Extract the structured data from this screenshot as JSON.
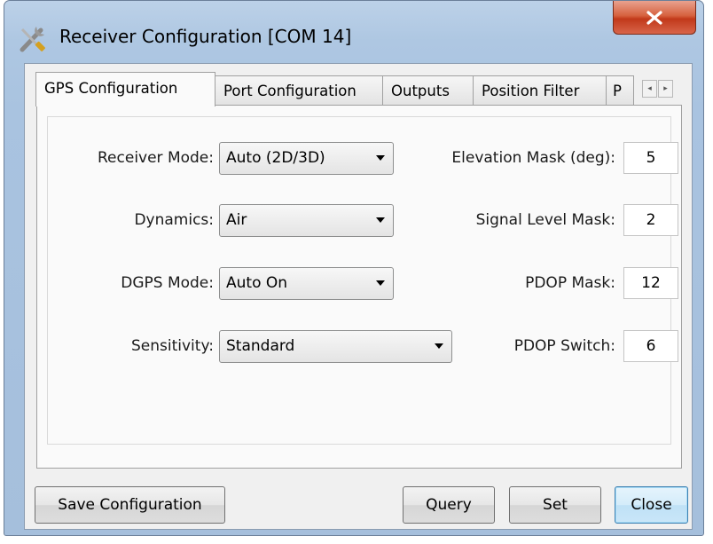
{
  "window": {
    "title": "Receiver Configuration [COM 14]",
    "close_glyph": "x"
  },
  "tabs": [
    {
      "label": "GPS Configuration",
      "active": true
    },
    {
      "label": "Port Configuration",
      "active": false
    },
    {
      "label": "Outputs",
      "active": false
    },
    {
      "label": "Position Filter",
      "active": false
    },
    {
      "label": "P",
      "active": false
    }
  ],
  "tab_scroll": {
    "left_icon": "arrow-left-icon",
    "right_icon": "arrow-right-icon",
    "left": "◂",
    "right": "▸"
  },
  "gps": {
    "receiver_mode": {
      "label": "Receiver Mode:",
      "value": "Auto (2D/3D)"
    },
    "dynamics": {
      "label": "Dynamics:",
      "value": "Air"
    },
    "dgps_mode": {
      "label": "DGPS Mode:",
      "value": "Auto On"
    },
    "sensitivity": {
      "label": "Sensitivity:",
      "value": "Standard"
    },
    "elevation_mask": {
      "label": "Elevation Mask (deg):",
      "value": "5"
    },
    "signal_level_mask": {
      "label": "Signal Level Mask:",
      "value": "2"
    },
    "pdop_mask": {
      "label": "PDOP Mask:",
      "value": "12"
    },
    "pdop_switch": {
      "label": "PDOP Switch:",
      "value": "6"
    }
  },
  "buttons": {
    "save": "Save Configuration",
    "query": "Query",
    "set": "Set",
    "close": "Close"
  },
  "colors": {
    "title_bar": "#aec7e2",
    "close_button": "#c1391a",
    "default_button": "#3c7fb1",
    "dialog_background": "#f0f0f0"
  }
}
